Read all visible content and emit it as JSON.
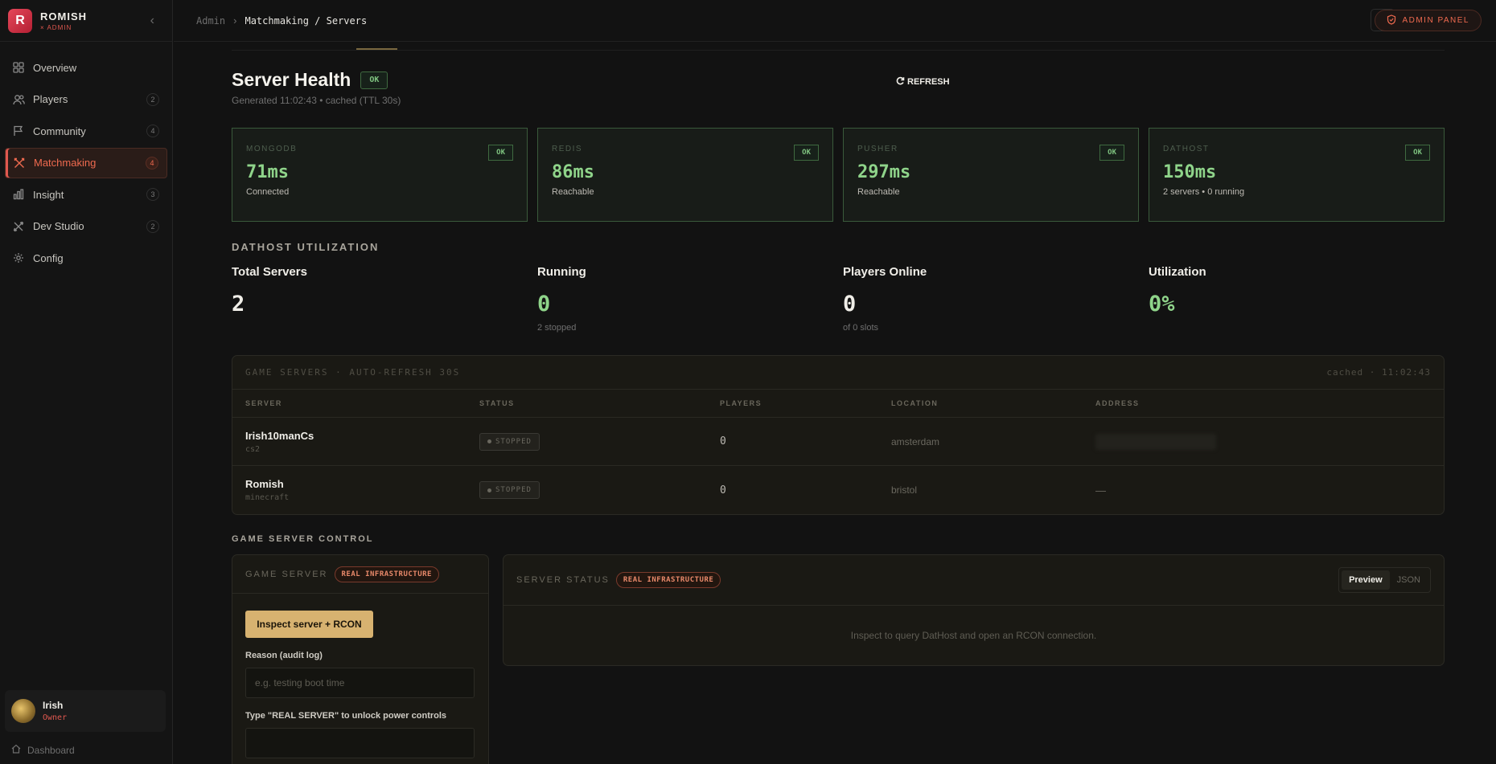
{
  "brand": {
    "logo_letter": "R",
    "name": "ROMISH",
    "sub": "× ADMIN"
  },
  "nav": [
    {
      "label": "Overview",
      "count": "",
      "icon": "grid-icon"
    },
    {
      "label": "Players",
      "count": "2",
      "icon": "users-icon"
    },
    {
      "label": "Community",
      "count": "4",
      "icon": "flag-icon"
    },
    {
      "label": "Matchmaking",
      "count": "4",
      "icon": "swords-icon",
      "active": true
    },
    {
      "label": "Insight",
      "count": "3",
      "icon": "bar-chart-icon"
    },
    {
      "label": "Dev Studio",
      "count": "2",
      "icon": "tools-icon"
    },
    {
      "label": "Config",
      "count": "",
      "icon": "gear-icon"
    }
  ],
  "user": {
    "name": "Irish",
    "role": "Owner"
  },
  "dashboard_link": "Dashboard",
  "breadcrumb": {
    "root": "Admin",
    "current": "Matchmaking / Servers"
  },
  "admin_panel_label": "ADMIN PANEL",
  "health": {
    "title": "Server Health",
    "status": "OK",
    "generated": "Generated 11:02:43 • cached (TTL 30s)",
    "refresh_label": "REFRESH"
  },
  "services": [
    {
      "name": "MONGODB",
      "status": "OK",
      "latency": "71ms",
      "detail": "Connected"
    },
    {
      "name": "REDIS",
      "status": "OK",
      "latency": "86ms",
      "detail": "Reachable"
    },
    {
      "name": "PUSHER",
      "status": "OK",
      "latency": "297ms",
      "detail": "Reachable"
    },
    {
      "name": "DATHOST",
      "status": "OK",
      "latency": "150ms",
      "detail": "2 servers • 0 running"
    }
  ],
  "utilization": {
    "section_title": "DATHOST UTILIZATION",
    "stats": [
      {
        "label": "Total Servers",
        "value": "2",
        "sub": "",
        "color": "#f0eee8"
      },
      {
        "label": "Running",
        "value": "0",
        "sub": "2 stopped",
        "color": "#8fd48a"
      },
      {
        "label": "Players Online",
        "value": "0",
        "sub": "of 0 slots",
        "color": "#f0eee8"
      },
      {
        "label": "Utilization",
        "value": "0%",
        "sub": "",
        "color": "#8fd48a"
      }
    ]
  },
  "game_servers": {
    "title": "GAME SERVERS · AUTO-REFRESH 30S",
    "cached": "cached · 11:02:43",
    "columns": [
      "SERVER",
      "STATUS",
      "PLAYERS",
      "LOCATION",
      "ADDRESS"
    ],
    "rows": [
      {
        "name": "Irish10manCs",
        "game": "cs2",
        "status": "STOPPED",
        "players": "0",
        "location": "amsterdam",
        "address": ""
      },
      {
        "name": "Romish",
        "game": "minecraft",
        "status": "STOPPED",
        "players": "0",
        "location": "bristol",
        "address": "—"
      }
    ]
  },
  "control": {
    "section_title": "GAME SERVER CONTROL",
    "game_server": {
      "title": "GAME SERVER",
      "badge": "REAL INFRASTRUCTURE",
      "inspect_button": "Inspect server + RCON",
      "reason_label": "Reason (audit log)",
      "reason_placeholder": "e.g. testing boot time",
      "confirm_label": "Type \"REAL SERVER\" to unlock power controls",
      "confirm_placeholder": ""
    },
    "server_status": {
      "title": "SERVER STATUS",
      "badge": "REAL INFRASTRUCTURE",
      "tabs": [
        "Preview",
        "JSON"
      ],
      "empty_text": "Inspect to query DatHost and open an RCON connection."
    }
  }
}
